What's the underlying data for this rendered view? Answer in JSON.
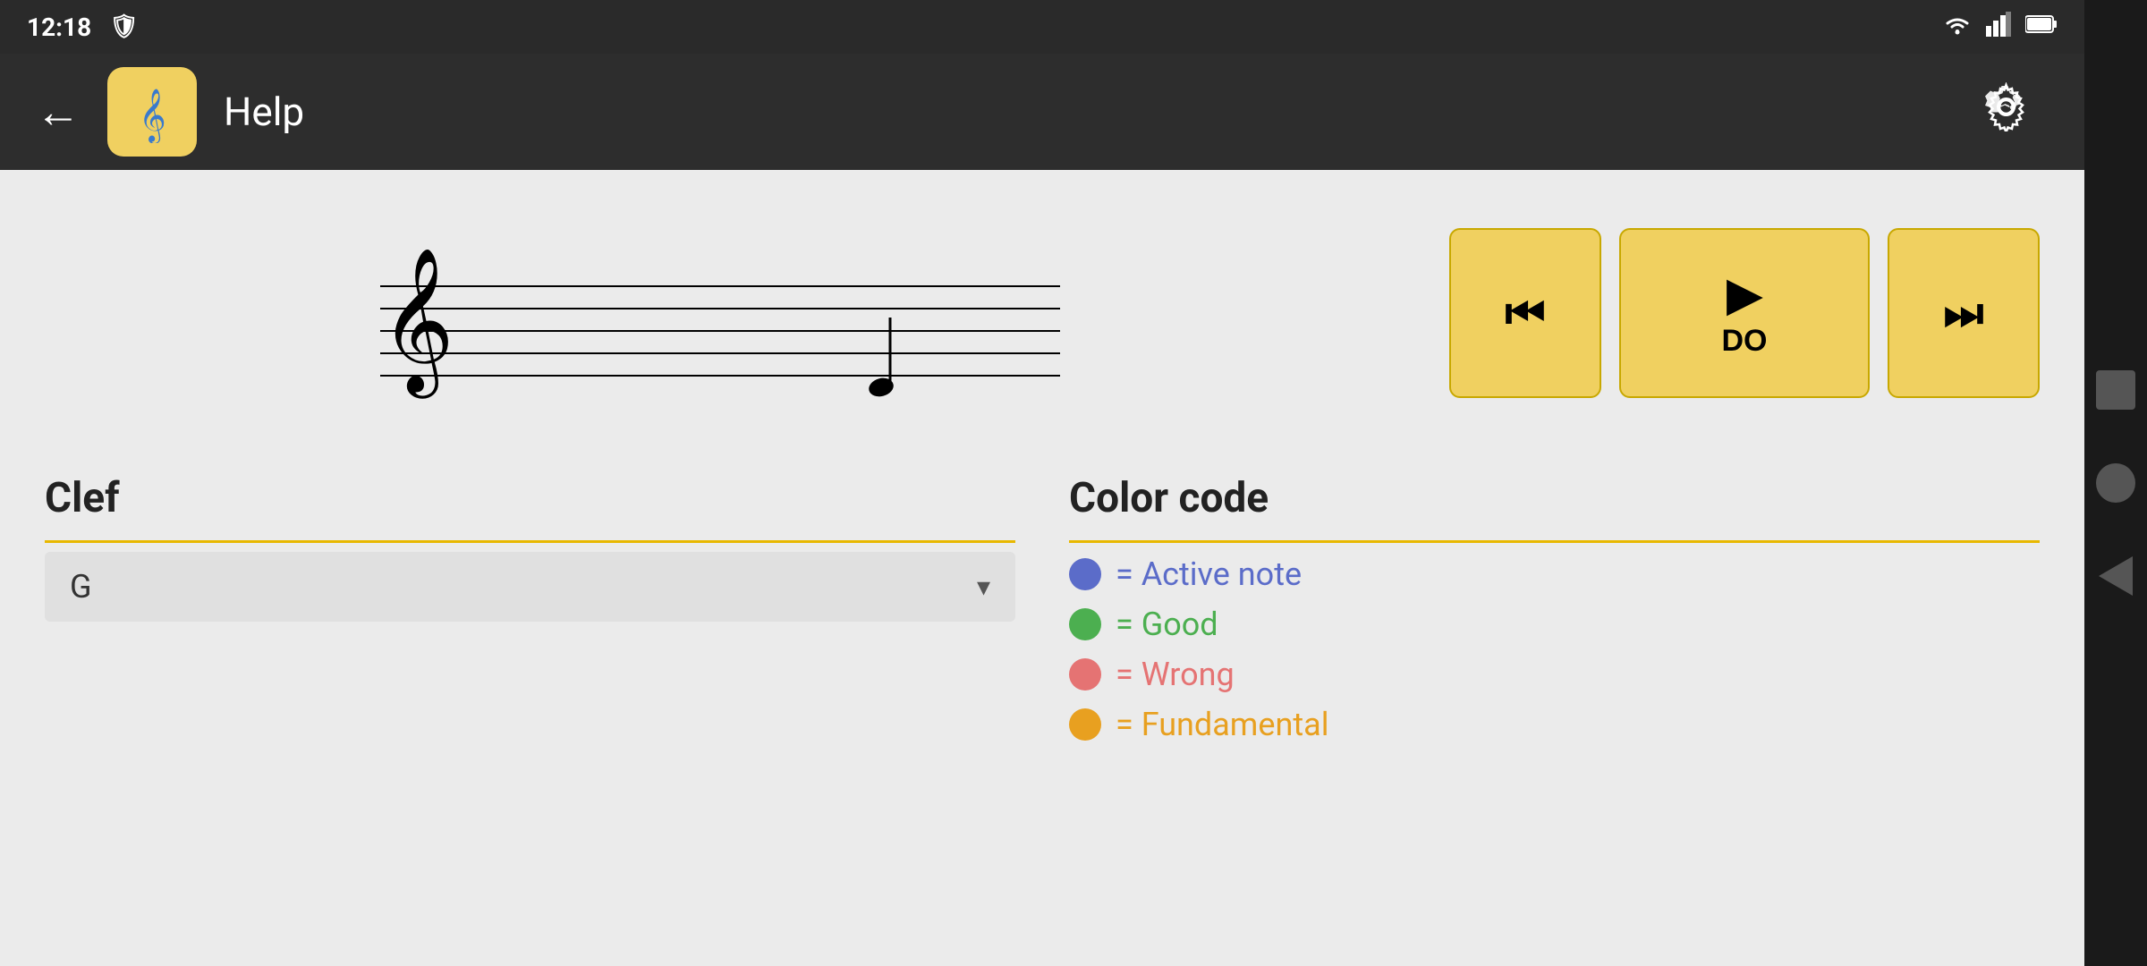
{
  "status_bar": {
    "time": "12:18",
    "icons": [
      "wifi",
      "signal",
      "battery"
    ]
  },
  "toolbar": {
    "back_label": "←",
    "app_icon_label": "🎵",
    "title": "Help",
    "settings_icon": "⚙"
  },
  "control_buttons": {
    "prev_label": "⏮",
    "play_label": "▶",
    "play_sublabel": "DO",
    "next_label": "⏭"
  },
  "clef_section": {
    "title": "Clef",
    "dropdown_value": "G",
    "dropdown_placeholder": "G"
  },
  "color_code_section": {
    "title": "Color code",
    "items": [
      {
        "color": "#5b6cc9",
        "text": "= Active note"
      },
      {
        "color": "#4caf50",
        "text": "= Good"
      },
      {
        "color": "#e57373",
        "text": "= Wrong"
      },
      {
        "color": "#e8a020",
        "text": "= Fundamental"
      }
    ]
  }
}
